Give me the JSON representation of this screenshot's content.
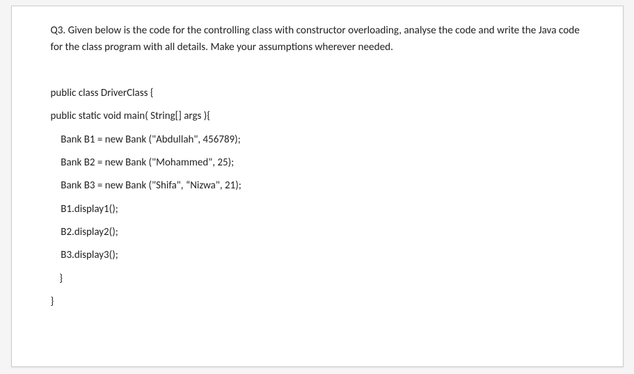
{
  "question": {
    "prompt": "Q3. Given below is the code for the controlling class with constructor overloading, analyse the code and write the Java code for the class program with all details. Make your assumptions wherever needed."
  },
  "code": {
    "lines": [
      "public class DriverClass {",
      "public static void main( String[] args ){",
      "  Bank B1 = new Bank (\"Abdullah\", 456789);",
      "  Bank B2 = new Bank (\"Mohammed\", 25);",
      "  Bank B3 = new Bank (\"Shifa\", “Nizwa\", 21);",
      "  B1.display1();",
      "  B2.display2();",
      "  B3.display3();",
      "  }",
      "}"
    ]
  }
}
